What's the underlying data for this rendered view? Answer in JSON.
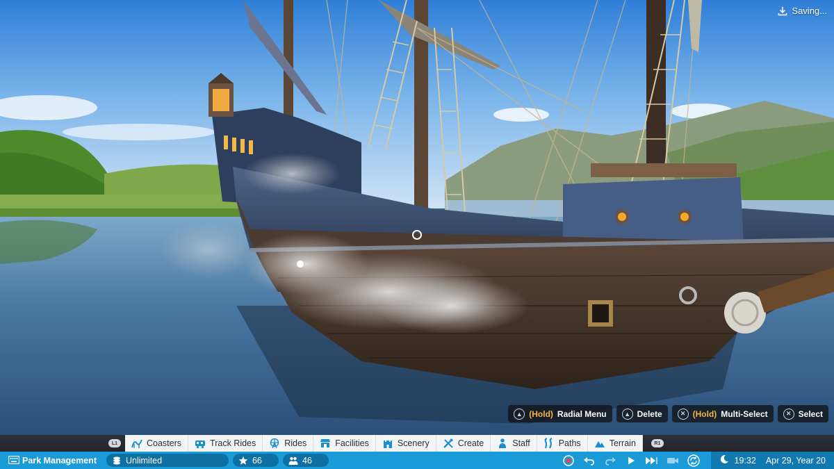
{
  "status_indicator": {
    "text": "Saving...",
    "icon": "download-icon"
  },
  "hints": [
    {
      "button_icon": "triangle-button-icon",
      "hold": "(Hold)",
      "label": "Radial Menu"
    },
    {
      "button_icon": "triangle-button-icon",
      "hold": "",
      "label": "Delete"
    },
    {
      "button_icon": "cross-button-icon",
      "hold": "(Hold)",
      "label": "Multi-Select"
    },
    {
      "button_icon": "cross-button-icon",
      "hold": "",
      "label": "Select"
    }
  ],
  "bumpers": {
    "left": "L1",
    "right": "R1"
  },
  "tabs": [
    {
      "label": "Coasters",
      "icon": "coaster-icon"
    },
    {
      "label": "Track Rides",
      "icon": "train-icon"
    },
    {
      "label": "Rides",
      "icon": "ferris-wheel-icon"
    },
    {
      "label": "Facilities",
      "icon": "shop-icon"
    },
    {
      "label": "Scenery",
      "icon": "castle-icon"
    },
    {
      "label": "Create",
      "icon": "tools-icon"
    },
    {
      "label": "Staff",
      "icon": "staff-icon"
    },
    {
      "label": "Paths",
      "icon": "path-icon"
    },
    {
      "label": "Terrain",
      "icon": "terrain-icon"
    }
  ],
  "statusbar": {
    "park_management": "Park Management",
    "money": "Unlimited",
    "rating": "66",
    "guests": "46",
    "time": "19:32",
    "date": "Apr 29, Year 20"
  },
  "colors": {
    "accent": "#1a9ad7",
    "hold_text": "#f5b642",
    "tab_icon": "#1a8fd0"
  }
}
